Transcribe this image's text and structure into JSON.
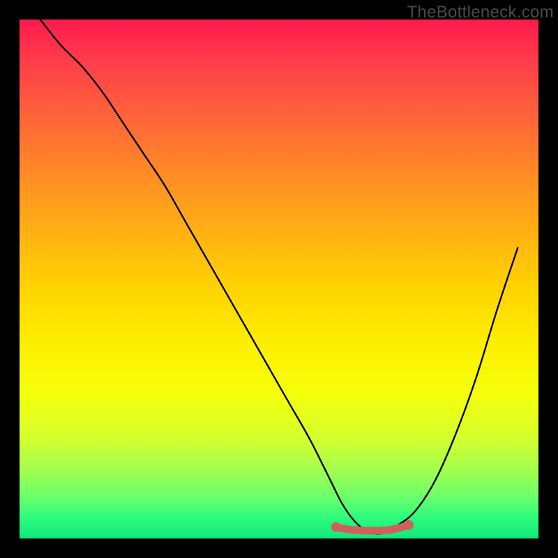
{
  "watermark": "TheBottleneck.com",
  "chart_data": {
    "type": "line",
    "title": "",
    "xlabel": "",
    "ylabel": "",
    "xlim": [
      0,
      100
    ],
    "ylim": [
      0,
      100
    ],
    "grid": false,
    "series": [
      {
        "name": "bottleneck-curve",
        "color": "#000000",
        "x": [
          4,
          8,
          12,
          16,
          20,
          24,
          28,
          32,
          36,
          40,
          44,
          48,
          52,
          56,
          60,
          62,
          64,
          66,
          68,
          70,
          72,
          76,
          80,
          84,
          88,
          92,
          96
        ],
        "y": [
          100,
          95,
          91,
          86,
          80,
          74,
          68,
          61,
          54,
          47,
          40,
          33,
          26,
          19,
          11,
          7,
          4,
          2,
          1,
          1,
          2,
          5,
          11,
          20,
          31,
          44,
          56
        ]
      },
      {
        "name": "highlight-segment",
        "color": "#d0605e",
        "x": [
          61,
          63,
          65,
          67,
          69,
          71,
          73,
          75
        ],
        "y": [
          2.2,
          1.8,
          1.6,
          1.5,
          1.5,
          1.6,
          2.0,
          2.6
        ]
      }
    ],
    "highlight_endpoints": {
      "left": {
        "x": 61,
        "y": 2.2
      },
      "right": {
        "x": 75,
        "y": 2.6
      }
    },
    "background_gradient_stops": [
      {
        "pct": 0,
        "color": "#ff1a4d"
      },
      {
        "pct": 25,
        "color": "#ff7a2e"
      },
      {
        "pct": 52,
        "color": "#ffd400"
      },
      {
        "pct": 72,
        "color": "#f5ff0a"
      },
      {
        "pct": 92,
        "color": "#6bff6b"
      },
      {
        "pct": 100,
        "color": "#12e87a"
      }
    ]
  }
}
